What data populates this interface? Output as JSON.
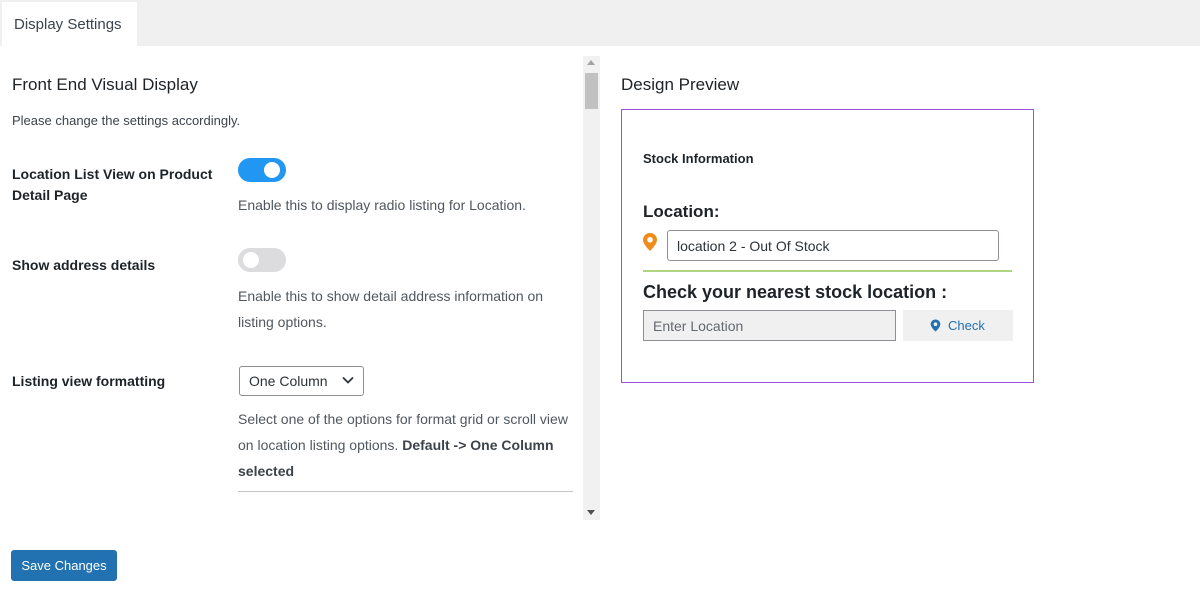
{
  "tabs": [
    {
      "label": "Display Settings",
      "active": true
    }
  ],
  "settings": {
    "title": "Front End Visual Display",
    "description": "Please change the settings accordingly.",
    "rows": [
      {
        "label": "Location List View on Product Detail Page",
        "toggle": true,
        "help": "Enable this to display radio listing for Location."
      },
      {
        "label": "Show address details",
        "toggle": false,
        "help": "Enable this to show detail address information on listing options."
      },
      {
        "label": "Listing view formatting",
        "select_value": "One Column",
        "help_prefix": "Select one of the options for format grid or scroll view on location listing options. ",
        "help_bold": "Default -> One Column selected"
      }
    ],
    "save_label": "Save Changes"
  },
  "preview": {
    "title": "Design Preview",
    "stock_info": "Stock Information",
    "location_label": "Location:",
    "location_value": "location 2 - Out Of Stock",
    "nearest_label": "Check your nearest stock location :",
    "enter_placeholder": "Enter Location",
    "check_label": "Check"
  },
  "colors": {
    "accent": "#2271b1",
    "toggle_on": "#2196f3",
    "preview_border": "#9b51e0",
    "pin": "#f08c1c",
    "divider_green": "#8bc34a"
  },
  "icons": {
    "pin": "map-pin-icon",
    "chevron": "chevron-down-icon"
  }
}
